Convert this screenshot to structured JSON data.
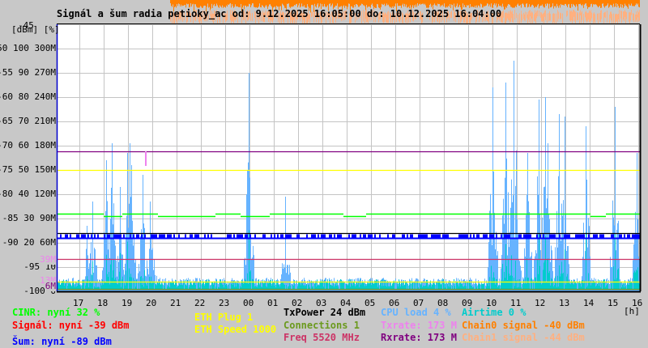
{
  "title": "Signál a šum radia petioky_ac od: 9.12.2025 16:05:00 do: 10.12.2025 16:04:00",
  "chart_data": {
    "type": "line",
    "title": "Signál a šum radia petioky_ac od: 9.12.2025 16:05:00 do: 10.12.2025 16:04:00",
    "xlabel": "[h]",
    "ylabel": "[dBm] [%]",
    "x_range": [
      "16:05",
      "16:04"
    ],
    "x_ticks": [
      "17",
      "18",
      "19",
      "20",
      "21",
      "22",
      "23",
      "00",
      "01",
      "02",
      "03",
      "04",
      "05",
      "06",
      "07",
      "08",
      "09",
      "10",
      "11",
      "12",
      "13",
      "14",
      "15",
      "16"
    ],
    "y_top_label": "-45",
    "y_range_dbm": [
      -100,
      -45
    ],
    "y_ticks": {
      "dbm": [
        "-50",
        "-55",
        "-60",
        "-65",
        "-70",
        "-75",
        "-80",
        "-85",
        "-90",
        "-95",
        "-100"
      ],
      "percent": [
        "100",
        "90",
        "80",
        "70",
        "60",
        "50",
        "40",
        "30",
        "20",
        "10",
        "0"
      ],
      "rate": [
        "300M",
        "270M",
        "240M",
        "210M",
        "180M",
        "150M",
        "120M",
        "90M",
        "60M"
      ]
    },
    "rate_markers": [
      {
        "label": "39M",
        "value": 39,
        "color": "#ee82ee"
      },
      {
        "label": "13M",
        "value": 13,
        "color": "#ee82ee"
      },
      {
        "label": "6M",
        "value": 6,
        "color": "#800080"
      }
    ],
    "grid": true,
    "lines": [
      {
        "name": "rxrate",
        "axis": "rate",
        "value": 173,
        "color": "#800080"
      },
      {
        "name": "eth-speed",
        "axis": "rate",
        "value": 150,
        "color": "#ffff00"
      },
      {
        "name": "cinr",
        "axis": "percent",
        "value": 32,
        "color": "#00ff00"
      },
      {
        "name": "txpower",
        "axis": "percent",
        "value": 24,
        "color": "#000000"
      },
      {
        "name": "noise",
        "axis": "dbm",
        "value": -89,
        "color": "#0000ff"
      },
      {
        "name": "freq",
        "axis": "rate",
        "value": 40,
        "color": "#cc3366"
      },
      {
        "name": "eth-plug",
        "axis": "percent",
        "value": 4,
        "color": "#ffff00"
      },
      {
        "name": "connections",
        "axis": "percent",
        "value": 1,
        "color": "#6b9a1e"
      }
    ],
    "txrate_dip": {
      "t": "19:43",
      "from": 173,
      "to": 155,
      "color": "#ee82ee"
    },
    "cpu_load_peaks_percent": [
      {
        "t": "17:19",
        "v": 27
      },
      {
        "t": "17:33",
        "v": 37
      },
      {
        "t": "18:07",
        "v": 54
      },
      {
        "t": "18:21",
        "v": 61
      },
      {
        "t": "18:41",
        "v": 43
      },
      {
        "t": "18:59",
        "v": 57
      },
      {
        "t": "19:05",
        "v": 61
      },
      {
        "t": "19:09",
        "v": 52
      },
      {
        "t": "19:37",
        "v": 48
      },
      {
        "t": "19:55",
        "v": 37
      },
      {
        "t": "20:05",
        "v": 13
      },
      {
        "t": "23:59",
        "v": 90
      },
      {
        "t": "01:29",
        "v": 39
      },
      {
        "t": "10:01",
        "v": 84
      },
      {
        "t": "10:33",
        "v": 86
      },
      {
        "t": "10:53",
        "v": 95
      },
      {
        "t": "10:59",
        "v": 58
      },
      {
        "t": "11:27",
        "v": 57
      },
      {
        "t": "11:55",
        "v": 79
      },
      {
        "t": "12:11",
        "v": 80
      },
      {
        "t": "12:17",
        "v": 61
      },
      {
        "t": "12:45",
        "v": 73
      },
      {
        "t": "12:59",
        "v": 72
      },
      {
        "t": "13:51",
        "v": 68
      },
      {
        "t": "15:03",
        "v": 76
      },
      {
        "t": "15:57",
        "v": 57
      },
      {
        "t": "16:04",
        "v": 47
      }
    ],
    "cpu_load_baseline_percent": 4,
    "airtime_baseline_percent": 2,
    "colors": {
      "cpu": "#66b3ff",
      "airtime": "#00cccc",
      "chain0": "#ff8000",
      "chain1": "#ffb080",
      "grid": "#c4c4c4"
    }
  },
  "legend": {
    "cinr": "CINR: nyní 32 %",
    "signal": "Signál: nyní -39 dBm",
    "noise": "Šum: nyní -89 dBm",
    "eth_plug": "ETH Plug 1",
    "eth_speed": "ETH Speed 1000",
    "txpower": "TxPower 24 dBm",
    "connections": "Connections 1",
    "freq": "Freq 5520 MHz",
    "cpu": "CPU load 4 %",
    "txrate": "Txrate: 173 M",
    "rxrate": "Rxrate: 173 M",
    "airtime": "Airtime 0 %",
    "chain0": "Chain0 signal -40 dBm",
    "chain1": "Chain1 signal -44 dBm"
  }
}
